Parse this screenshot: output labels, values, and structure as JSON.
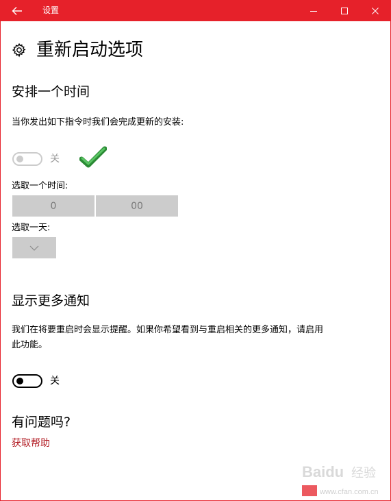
{
  "window": {
    "title": "设置"
  },
  "page": {
    "title": "重新启动选项"
  },
  "schedule": {
    "heading": "安排一个时间",
    "description": "当你发出如下指令时我们会完成更新的安装:",
    "toggle_state": "关",
    "toggle_on": false,
    "time_label": "选取一个时间:",
    "hour_value": "0",
    "minute_value": "00",
    "day_label": "选取一天:"
  },
  "notifications": {
    "heading": "显示更多通知",
    "description_line1": "我们在将要重启时会显示提醒。如果你希望看到与重启相关的更多通知，请启用",
    "description_line2": "此功能。",
    "toggle_state": "关",
    "toggle_on": false
  },
  "help": {
    "heading": "有问题吗?",
    "link": "获取帮助"
  },
  "watermark": {
    "brand": "Baidu",
    "text": "经验",
    "site": "www.cfan.com.cn"
  },
  "colors": {
    "accent": "#e6212a",
    "link": "#b21c24",
    "disabled": "#cccccc",
    "annotation_check": "#2fa33a"
  }
}
